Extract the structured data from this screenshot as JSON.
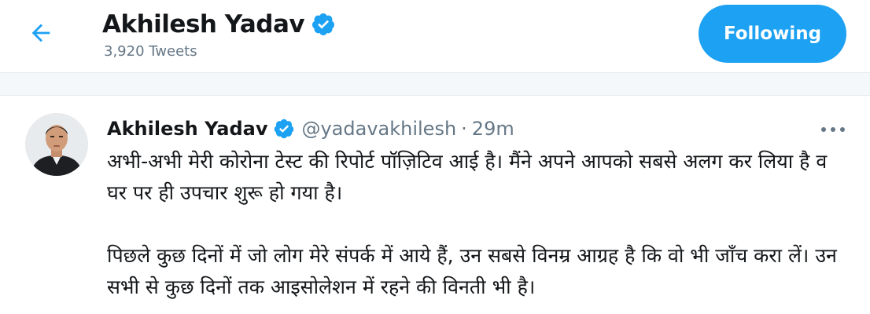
{
  "header": {
    "back_icon": "arrow-left-icon",
    "profile_name": "Akhilesh Yadav",
    "verified_icon": "verified-badge-icon",
    "tweet_count": "3,920 Tweets",
    "follow_label": "Following"
  },
  "tweet": {
    "author_name": "Akhilesh Yadav",
    "handle": "@yadavakhilesh",
    "separator": "·",
    "time": "29m",
    "more_icon": "more-horizontal-icon",
    "paragraphs": [
      "अभी-अभी मेरी कोरोना टेस्ट की रिपोर्ट पॉज़िटिव आई है। मैंने अपने आपको सबसे अलग कर लिया है व घर पर ही उपचार शुरू हो गया है।",
      "पिछले कुछ दिनों में जो लोग मेरे संपर्क में आये हैं, उन सबसे विनम्र आग्रह है कि वो भी जाँच करा लें। उन सभी से कुछ दिनों तक आइसोलेशन में रहने की विनती भी है।"
    ]
  },
  "colors": {
    "accent": "#1da1f2",
    "text_primary": "#14171a",
    "text_secondary": "#657786",
    "band": "#f5f8fa"
  }
}
